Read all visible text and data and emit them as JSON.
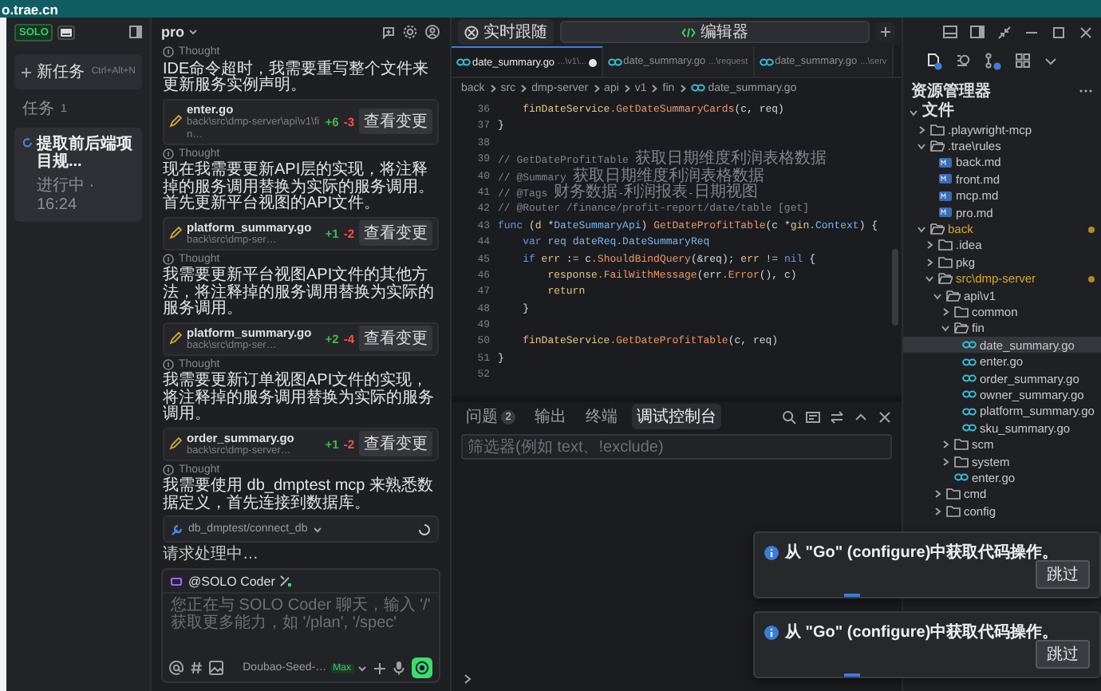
{
  "browser": {
    "address": "o.trae.cn"
  },
  "tasks": {
    "logo": "SOLO",
    "new_task": {
      "label": "新任务",
      "shortcut": "Ctrl+Alt+N"
    },
    "heading": "任务",
    "count": "1",
    "items": [
      {
        "title": "提取前后端项目规...",
        "status": "进行中 · 16:24",
        "selected": true
      }
    ]
  },
  "chat": {
    "title": "pro",
    "messages": [
      {
        "kind": "thought",
        "label": "Thought"
      },
      {
        "kind": "text",
        "text": "IDE命令超时，我需要重写整个文件来更新服务实例声明。"
      },
      {
        "kind": "file",
        "name": "enter.go",
        "path": "back\\src\\dmp-server\\api\\v1\\fin…",
        "added": "+6",
        "removed": "-3",
        "button": "查看变更"
      },
      {
        "kind": "thought",
        "label": "Thought"
      },
      {
        "kind": "text",
        "text": "现在我需要更新API层的实现，将注释掉的服务调用替换为实际的服务调用。首先更新平台视图的API文件。"
      },
      {
        "kind": "file",
        "name": "platform_summary.go",
        "path": "back\\src\\dmp-ser…",
        "added": "+1",
        "removed": "-2",
        "button": "查看变更"
      },
      {
        "kind": "thought",
        "label": "Thought"
      },
      {
        "kind": "text",
        "text": "我需要更新平台视图API文件的其他方法，将注释掉的服务调用替换为实际的服务调用。"
      },
      {
        "kind": "file",
        "name": "platform_summary.go",
        "path": "back\\src\\dmp-ser…",
        "added": "+2",
        "removed": "-4",
        "button": "查看变更"
      },
      {
        "kind": "thought",
        "label": "Thought"
      },
      {
        "kind": "text",
        "text": "我需要更新订单视图API文件的实现，将注释掉的服务调用替换为实际的服务调用。"
      },
      {
        "kind": "file",
        "name": "order_summary.go",
        "path": "back\\src\\dmp-server…",
        "added": "+1",
        "removed": "-2",
        "button": "查看变更"
      },
      {
        "kind": "thought",
        "label": "Thought"
      },
      {
        "kind": "text",
        "text": "我需要使用 db_dmptest mcp 来熟悉数据定义，首先连接到数据库。"
      },
      {
        "kind": "tool",
        "name": "db_dmptest/connect_db",
        "running": true
      },
      {
        "kind": "status",
        "text": "请求处理中…"
      }
    ],
    "composer": {
      "mention": "@SOLO Coder",
      "placeholder": "您正在与 SOLO Coder 聊天，输入 '/' 获取更多能力，如 '/plan', '/spec'",
      "model": "Doubao-Seed-…",
      "badge": "Max"
    }
  },
  "editor": {
    "follow_button": "实时跟随",
    "view_tab": "编辑器",
    "tabs": [
      {
        "name": "date_summary.go",
        "path": "...\\v1\\...",
        "modified": true,
        "selected": true
      },
      {
        "name": "date_summary.go",
        "path": "...\\request",
        "modified": false,
        "selected": false
      },
      {
        "name": "date_summary.go",
        "path": "...\\serv",
        "modified": false,
        "selected": false
      }
    ],
    "breadcrumb": [
      "back",
      "src",
      "dmp-server",
      "api",
      "v1",
      "fin",
      "date_summary.go"
    ],
    "lines": [
      {
        "number": "36",
        "tokens": [
          {
            "kind": "var",
            "text": "    finDateService"
          },
          {
            "kind": "func",
            "text": ".GetDateSummaryCards"
          },
          {
            "kind": "plain",
            "text": "(c, req)"
          }
        ]
      },
      {
        "number": "37",
        "tokens": [
          {
            "kind": "plain",
            "text": "}"
          }
        ]
      },
      {
        "number": "38"
      },
      {
        "number": "39",
        "tokens": [
          {
            "kind": "comment",
            "text": "// GetDateProfitTable 获取日期维度利润表格数据"
          }
        ]
      },
      {
        "number": "40",
        "tokens": [
          {
            "kind": "comment",
            "text": "// @Summary 获取日期维度利润表格数据"
          }
        ]
      },
      {
        "number": "41",
        "tokens": [
          {
            "kind": "comment",
            "text": "// @Tags 财务数据-利润报表-日期视图"
          }
        ]
      },
      {
        "number": "42",
        "tokens": [
          {
            "kind": "comment",
            "text": "// @Router /finance/profit-report/date/table [get]"
          }
        ]
      },
      {
        "number": "43",
        "tokens": [
          {
            "kind": "keyword",
            "text": "func"
          },
          {
            "kind": "plain",
            "text": " ("
          },
          {
            "kind": "var",
            "text": "d"
          },
          {
            "kind": "plain",
            "text": " *"
          },
          {
            "kind": "type",
            "text": "DateSummaryApi"
          },
          {
            "kind": "plain",
            "text": ") "
          },
          {
            "kind": "func",
            "text": "GetDateProfitTable"
          },
          {
            "kind": "plain",
            "text": "(c *"
          },
          {
            "kind": "var",
            "text": "gin"
          },
          {
            "kind": "type",
            "text": ".Context"
          },
          {
            "kind": "plain",
            "text": ") {"
          }
        ]
      },
      {
        "number": "44",
        "tokens": [
          {
            "kind": "keyword",
            "text": "    var"
          },
          {
            "kind": "type",
            "text": " req"
          },
          {
            "kind": "type",
            "text": " dateReq"
          },
          {
            "kind": "type",
            "text": ".DateSummaryReq"
          }
        ]
      },
      {
        "number": "45",
        "tokens": [
          {
            "kind": "keyword",
            "text": "    if"
          },
          {
            "kind": "var",
            "text": " err"
          },
          {
            "kind": "plain",
            "text": " := c"
          },
          {
            "kind": "func",
            "text": ".ShouldBindQuery"
          },
          {
            "kind": "plain",
            "text": "(&req); "
          },
          {
            "kind": "var",
            "text": "err"
          },
          {
            "kind": "plain",
            "text": " != "
          },
          {
            "kind": "keyword",
            "text": "nil"
          },
          {
            "kind": "plain",
            "text": " {"
          }
        ]
      },
      {
        "number": "46",
        "tokens": [
          {
            "kind": "var",
            "text": "        response"
          },
          {
            "kind": "func",
            "text": ".FailWithMessage"
          },
          {
            "kind": "plain",
            "text": "(err"
          },
          {
            "kind": "func",
            "text": ".Error"
          },
          {
            "kind": "plain",
            "text": "(), c)"
          }
        ]
      },
      {
        "number": "47",
        "tokens": [
          {
            "kind": "var",
            "text": "        return"
          }
        ]
      },
      {
        "number": "48",
        "tokens": [
          {
            "kind": "plain",
            "text": "    }"
          }
        ]
      },
      {
        "number": "49"
      },
      {
        "number": "50",
        "tokens": [
          {
            "kind": "var",
            "text": "    finDateService"
          },
          {
            "kind": "func",
            "text": ".GetDateProfitTable"
          },
          {
            "kind": "plain",
            "text": "(c, req)"
          }
        ]
      },
      {
        "number": "51",
        "tokens": [
          {
            "kind": "plain",
            "text": "}"
          }
        ]
      },
      {
        "number": "52"
      }
    ],
    "panel": {
      "tabs": [
        {
          "label": "问题",
          "count": "2",
          "selected": false
        },
        {
          "label": "输出",
          "selected": false
        },
        {
          "label": "终端",
          "selected": false
        },
        {
          "label": "调试控制台",
          "selected": true
        }
      ],
      "filter_placeholder": "筛选器(例如 text、!exclude)"
    }
  },
  "explorer": {
    "title": "资源管理器",
    "tree": [
      {
        "name": "文件",
        "kind": "section",
        "expanded": true,
        "selected": false,
        "modified": false,
        "children": [
          {
            "name": ".playwright-mcp",
            "kind": "folder",
            "expanded": false,
            "selected": false,
            "modified": false
          },
          {
            "name": ".trae\\rules",
            "kind": "folder",
            "expanded": true,
            "selected": false,
            "modified": false,
            "children": [
              {
                "name": "back.md",
                "kind": "md",
                "selected": false,
                "modified": false
              },
              {
                "name": "front.md",
                "kind": "md",
                "selected": false,
                "modified": false
              },
              {
                "name": "mcp.md",
                "kind": "md",
                "selected": false,
                "modified": false
              },
              {
                "name": "pro.md",
                "kind": "md",
                "selected": false,
                "modified": false
              }
            ]
          },
          {
            "name": "back",
            "kind": "folder",
            "expanded": true,
            "selected": false,
            "modified": true,
            "children": [
              {
                "name": ".idea",
                "kind": "folder",
                "expanded": false,
                "selected": false,
                "modified": false
              },
              {
                "name": "pkg",
                "kind": "folder",
                "expanded": false,
                "selected": false,
                "modified": false
              },
              {
                "name": "src\\dmp-server",
                "kind": "folder",
                "expanded": true,
                "selected": false,
                "modified": true,
                "children": [
                  {
                    "name": "api\\v1",
                    "kind": "folder",
                    "expanded": true,
                    "selected": false,
                    "modified": false,
                    "children": [
                      {
                        "name": "common",
                        "kind": "folder",
                        "expanded": false,
                        "selected": false,
                        "modified": false
                      },
                      {
                        "name": "fin",
                        "kind": "folder",
                        "expanded": true,
                        "selected": false,
                        "modified": false,
                        "children": [
                          {
                            "name": "date_summary.go",
                            "kind": "go",
                            "selected": true,
                            "modified": false
                          },
                          {
                            "name": "enter.go",
                            "kind": "go",
                            "selected": false,
                            "modified": false
                          },
                          {
                            "name": "order_summary.go",
                            "kind": "go",
                            "selected": false,
                            "modified": false
                          },
                          {
                            "name": "owner_summary.go",
                            "kind": "go",
                            "selected": false,
                            "modified": false
                          },
                          {
                            "name": "platform_summary.go",
                            "kind": "go",
                            "selected": false,
                            "modified": false
                          },
                          {
                            "name": "sku_summary.go",
                            "kind": "go",
                            "selected": false,
                            "modified": false
                          }
                        ]
                      },
                      {
                        "name": "scm",
                        "kind": "folder",
                        "expanded": false,
                        "selected": false,
                        "modified": false
                      },
                      {
                        "name": "system",
                        "kind": "folder",
                        "expanded": false,
                        "selected": false,
                        "modified": false
                      },
                      {
                        "name": "enter.go",
                        "kind": "go",
                        "selected": false,
                        "modified": false
                      }
                    ]
                  },
                  {
                    "name": "cmd",
                    "kind": "folder",
                    "expanded": false,
                    "selected": false,
                    "modified": false
                  },
                  {
                    "name": "config",
                    "kind": "folder",
                    "expanded": false,
                    "selected": false,
                    "modified": false
                  }
                ]
              }
            ]
          }
        ]
      }
    ]
  },
  "notifications": [
    {
      "message": "从 \"Go\" (configure)中获取代码操作。",
      "button": "跳过"
    },
    {
      "message": "从 \"Go\" (configure)中获取代码操作。",
      "button": "跳过"
    }
  ]
}
